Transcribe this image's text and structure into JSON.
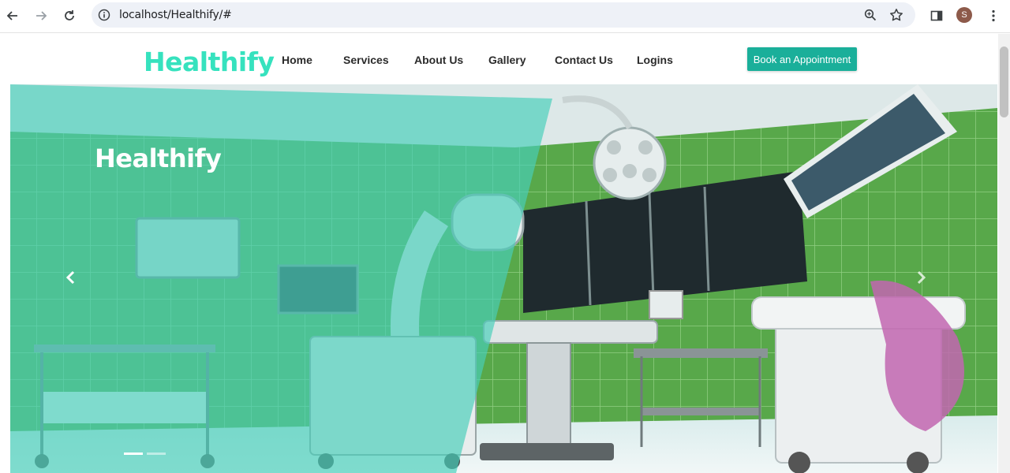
{
  "browser": {
    "url": "localhost/Healthify/#",
    "profile_initial": "S",
    "icons": [
      "back-arrow-icon",
      "forward-arrow-icon",
      "reload-icon",
      "info-icon",
      "zoom-icon",
      "star-icon",
      "side-panel-icon",
      "kebab-menu-icon"
    ]
  },
  "header": {
    "logo": "Healthify",
    "menu": [
      {
        "label": "Home"
      },
      {
        "label": "Services"
      },
      {
        "label": "About Us"
      },
      {
        "label": "Gallery"
      },
      {
        "label": "Contact Us"
      },
      {
        "label": "Logins"
      }
    ],
    "cta": "Book an Appointment"
  },
  "hero": {
    "title": "Healthify",
    "slides_total": 2,
    "active_slide": 1
  },
  "colors": {
    "brand": "#36e2be",
    "button": "#1aaf9a",
    "overlay": "#48ceb9"
  }
}
